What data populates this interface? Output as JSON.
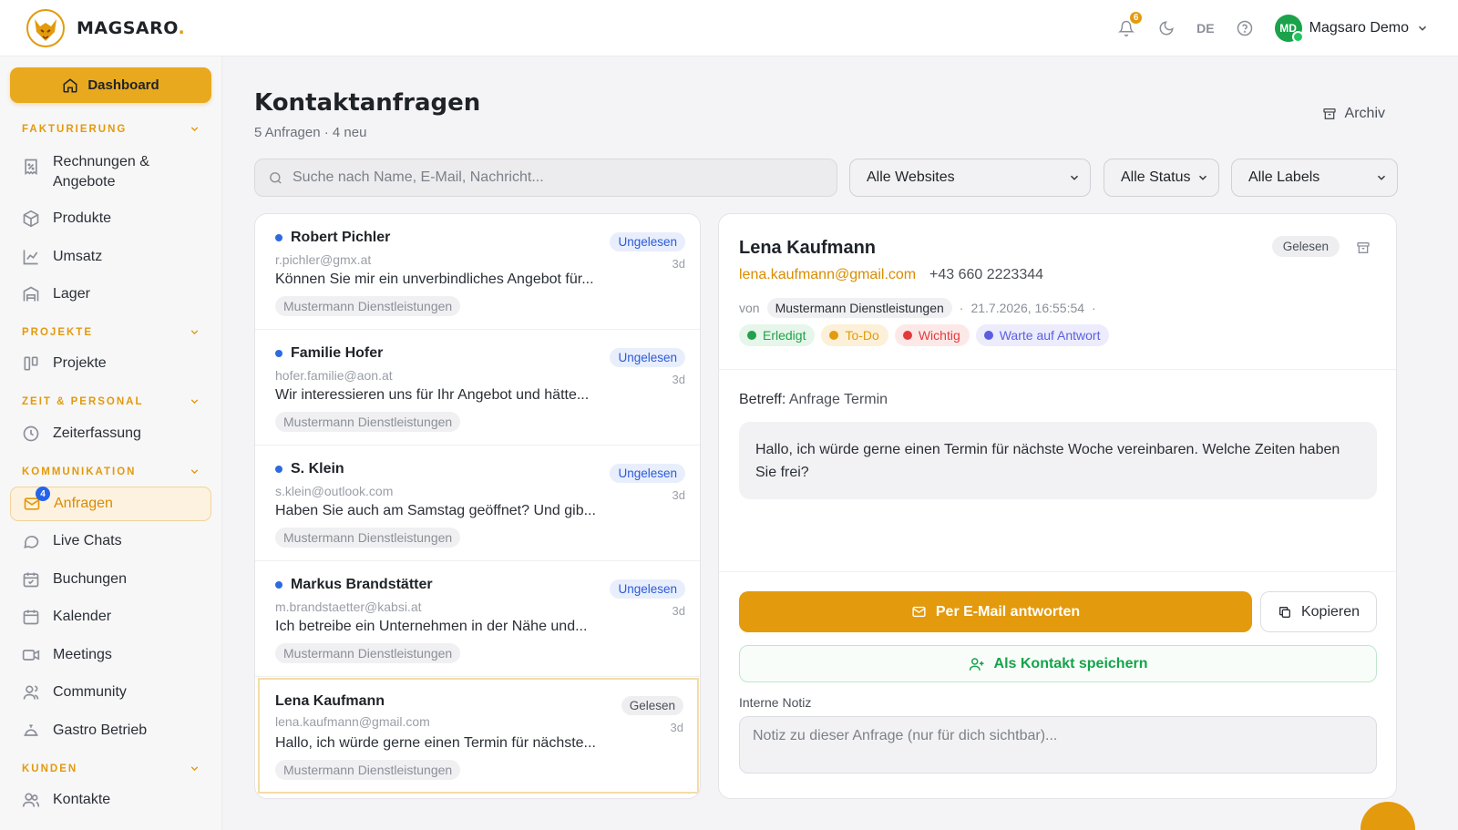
{
  "brand": {
    "name": "MAGSARO",
    "dot": ".",
    "accent": "#e39a0c"
  },
  "topbar": {
    "notifications": "6",
    "language": "DE",
    "avatar_initials": "MD",
    "user_name": "Magsaro Demo"
  },
  "sidebar": {
    "dashboard": "Dashboard",
    "sections": [
      {
        "title": "FAKTURIERUNG",
        "items": [
          "Rechnungen &",
          "Angebote",
          "Produkte",
          "Umsatz",
          "Lager"
        ]
      },
      {
        "title": "PROJEKTE",
        "items": [
          "Projekte"
        ]
      },
      {
        "title": "ZEIT & PERSONAL",
        "items": [
          "Zeiterfassung"
        ]
      },
      {
        "title": "KOMMUNIKATION",
        "items": [
          "Anfragen",
          "Live Chats",
          "Buchungen",
          "Kalender",
          "Meetings",
          "Community",
          "Gastro Betrieb"
        ]
      },
      {
        "title": "KUNDEN",
        "items": [
          "Kontakte"
        ]
      }
    ],
    "anfragen_badge": "4"
  },
  "page": {
    "title": "Kontaktanfragen",
    "subtitle": "5 Anfragen · 4 neu",
    "archive": "Archiv",
    "search_placeholder": "Suche nach Name, E-Mail, Nachricht...",
    "filters": [
      "Alle Websites",
      "Alle Status",
      "Alle Labels"
    ]
  },
  "requests": [
    {
      "name": "Robert Pichler",
      "email": "r.pichler@gmx.at",
      "message": "Können Sie mir ein unverbindliches Angebot für...",
      "site": "Mustermann Dienstleistungen",
      "status": "Ungelesen",
      "age": "3d"
    },
    {
      "name": "Familie Hofer",
      "email": "hofer.familie@aon.at",
      "message": "Wir interessieren uns für Ihr Angebot und hätte...",
      "site": "Mustermann Dienstleistungen",
      "status": "Ungelesen",
      "age": "3d"
    },
    {
      "name": "S. Klein",
      "email": "s.klein@outlook.com",
      "message": "Haben Sie auch am Samstag geöffnet? Und gib...",
      "site": "Mustermann Dienstleistungen",
      "status": "Ungelesen",
      "age": "3d"
    },
    {
      "name": "Markus Brandstätter",
      "email": "m.brandstaetter@kabsi.at",
      "message": "Ich betreibe ein Unternehmen in der Nähe und...",
      "site": "Mustermann Dienstleistungen",
      "status": "Ungelesen",
      "age": "3d"
    },
    {
      "name": "Lena Kaufmann",
      "email": "lena.kaufmann@gmail.com",
      "message": "Hallo, ich würde gerne einen Termin für nächste...",
      "site": "Mustermann Dienstleistungen",
      "status": "Gelesen",
      "age": "3d"
    }
  ],
  "detail": {
    "name": "Lena Kaufmann",
    "status": "Gelesen",
    "email": "lena.kaufmann@gmail.com",
    "phone": "+43 660 2223344",
    "from_label": "von",
    "site": "Mustermann Dienstleistungen",
    "timestamp": "21.7.2026, 16:55:54",
    "tags": [
      {
        "label": "Erledigt",
        "color": "#22a04b",
        "bg": "#e6f6ea"
      },
      {
        "label": "To-Do",
        "color": "#e39a0c",
        "bg": "#fdf0d8"
      },
      {
        "label": "Wichtig",
        "color": "#e23b3b",
        "bg": "#fde8e8"
      },
      {
        "label": "Warte auf Antwort",
        "color": "#5b5fdf",
        "bg": "#ececfc"
      }
    ],
    "subject_label": "Betreff:",
    "subject": "Anfrage Termin",
    "body": "Hallo, ich würde gerne einen Termin für nächste Woche vereinbaren. Welche Zeiten haben Sie frei?",
    "reply_button": "Per E-Mail antworten",
    "copy_button": "Kopieren",
    "save_contact_button": "Als Kontakt speichern",
    "note_label": "Interne Notiz",
    "note_placeholder": "Notiz zu dieser Anfrage (nur für dich sichtbar)..."
  }
}
